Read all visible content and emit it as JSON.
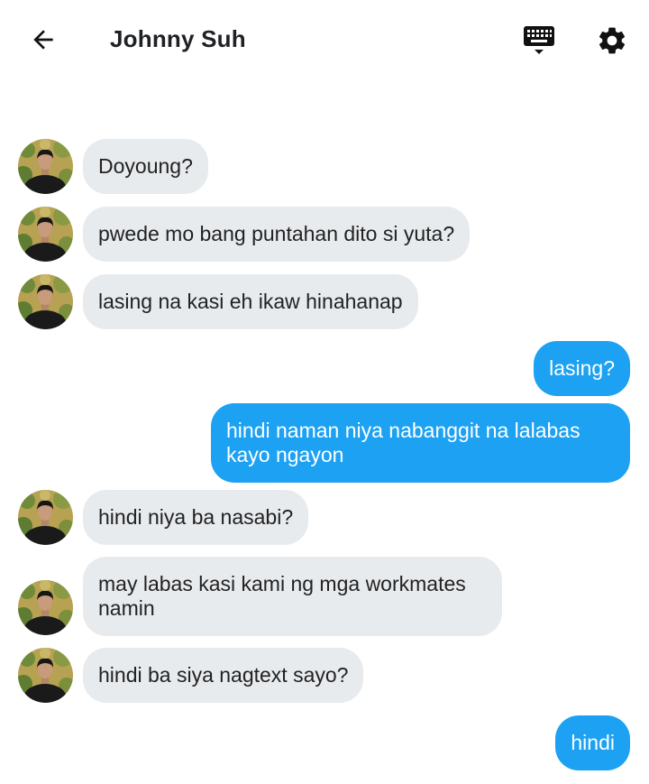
{
  "header": {
    "title": "Johnny Suh"
  },
  "icons": {
    "back": "arrow-left-icon",
    "keyboard": "keyboard-icon",
    "settings": "gear-icon"
  },
  "colors": {
    "outgoing_bubble": "#1da1f2",
    "incoming_bubble": "#e8ebee"
  },
  "messages": [
    {
      "direction": "incoming",
      "text": "Doyoung?"
    },
    {
      "direction": "incoming",
      "text": "pwede mo bang puntahan dito si yuta?"
    },
    {
      "direction": "incoming",
      "text": "lasing na kasi eh ikaw hinahanap"
    },
    {
      "direction": "outgoing",
      "text": "lasing?"
    },
    {
      "direction": "outgoing",
      "text": "hindi naman niya nabanggit na lalabas kayo ngayon"
    },
    {
      "direction": "incoming",
      "text": "hindi niya ba nasabi?"
    },
    {
      "direction": "incoming",
      "text": "may labas kasi kami ng mga workmates namin"
    },
    {
      "direction": "incoming",
      "text": "hindi ba siya nagtext sayo?"
    },
    {
      "direction": "outgoing",
      "text": "hindi"
    }
  ]
}
